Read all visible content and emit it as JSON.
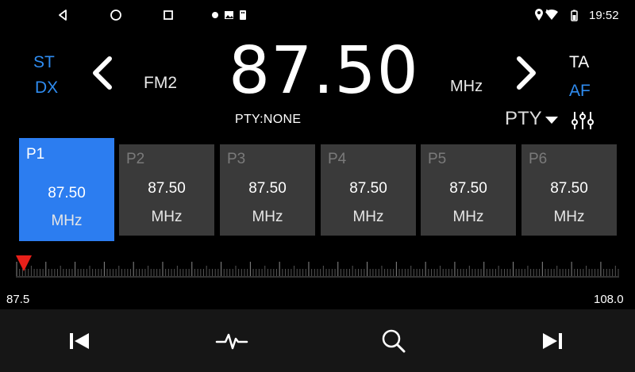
{
  "status_bar": {
    "time": "19:52",
    "nav": [
      "back-icon",
      "home-icon",
      "recents-icon"
    ],
    "notifications": [
      "notification-dot-icon",
      "image-icon",
      "usb-icon"
    ],
    "system": [
      "location-icon",
      "wifi-icon",
      "battery-icon"
    ]
  },
  "radio": {
    "st_label": "ST",
    "dx_label": "DX",
    "band": "FM2",
    "frequency": "87.50",
    "unit": "MHz",
    "ta_label": "TA",
    "af_label": "AF",
    "pty_status": "PTY:NONE",
    "pty_button": "PTY",
    "colors": {
      "accent": "#2c7df0",
      "active_blue": "#2f8cf0",
      "preset_bg": "#3a3a3a"
    }
  },
  "presets": [
    {
      "name": "P1",
      "freq": "87.50",
      "unit": "MHz",
      "active": true
    },
    {
      "name": "P2",
      "freq": "87.50",
      "unit": "MHz",
      "active": false
    },
    {
      "name": "P3",
      "freq": "87.50",
      "unit": "MHz",
      "active": false
    },
    {
      "name": "P4",
      "freq": "87.50",
      "unit": "MHz",
      "active": false
    },
    {
      "name": "P5",
      "freq": "87.50",
      "unit": "MHz",
      "active": false
    },
    {
      "name": "P6",
      "freq": "87.50",
      "unit": "MHz",
      "active": false
    }
  ],
  "scale": {
    "min_label": "87.5",
    "max_label": "108.0",
    "min": 87.5,
    "max": 108.0,
    "current": 87.5
  },
  "bottom_bar": [
    "previous-track-icon",
    "scan-waveform-icon",
    "search-icon",
    "next-track-icon"
  ]
}
